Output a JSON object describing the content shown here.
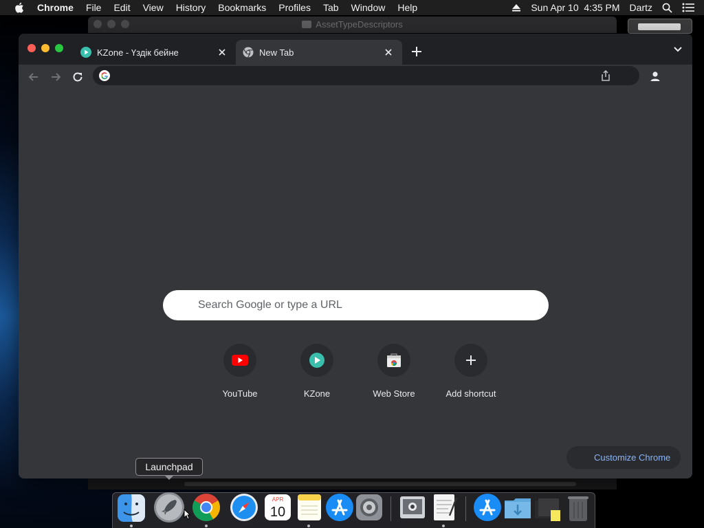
{
  "menubar": {
    "apple_icon": "apple-icon",
    "app_name": "Chrome",
    "items": [
      "File",
      "Edit",
      "View",
      "History",
      "Bookmarks",
      "Profiles",
      "Tab",
      "Window",
      "Help"
    ],
    "date_time": "Sun Apr 10  4:35 PM",
    "user": "Dartz"
  },
  "background_window": {
    "title": "AssetTypeDescriptors"
  },
  "chrome": {
    "tabs": [
      {
        "title": "KZone - Үздік бейне",
        "favicon": "kzone-icon",
        "active": false
      },
      {
        "title": "New Tab",
        "favicon": "chrome-icon",
        "active": true
      }
    ],
    "omnibox": {
      "value": ""
    },
    "ntp": {
      "search_placeholder": "Search Google or type a URL",
      "shortcuts": [
        {
          "label": "YouTube",
          "icon": "youtube-icon"
        },
        {
          "label": "KZone",
          "icon": "kzone-icon"
        },
        {
          "label": "Web Store",
          "icon": "web-store-icon"
        },
        {
          "label": "Add shortcut",
          "icon": "plus-icon"
        }
      ],
      "customize_label": "Customize Chrome"
    }
  },
  "tooltip": {
    "text": "Launchpad"
  },
  "dock": {
    "items": [
      "Finder",
      "Launchpad",
      "Google Chrome",
      "Safari",
      "Calendar",
      "Notes",
      "App Store",
      "System Preferences",
      "Preview",
      "TextEdit",
      "App Store",
      "Downloads",
      "Stack",
      "Trash"
    ],
    "calendar_month": "APR",
    "calendar_day": "10"
  },
  "colors": {
    "frame": "#202124",
    "toolbar": "#35363a",
    "link_blue": "#8ab4f8"
  }
}
